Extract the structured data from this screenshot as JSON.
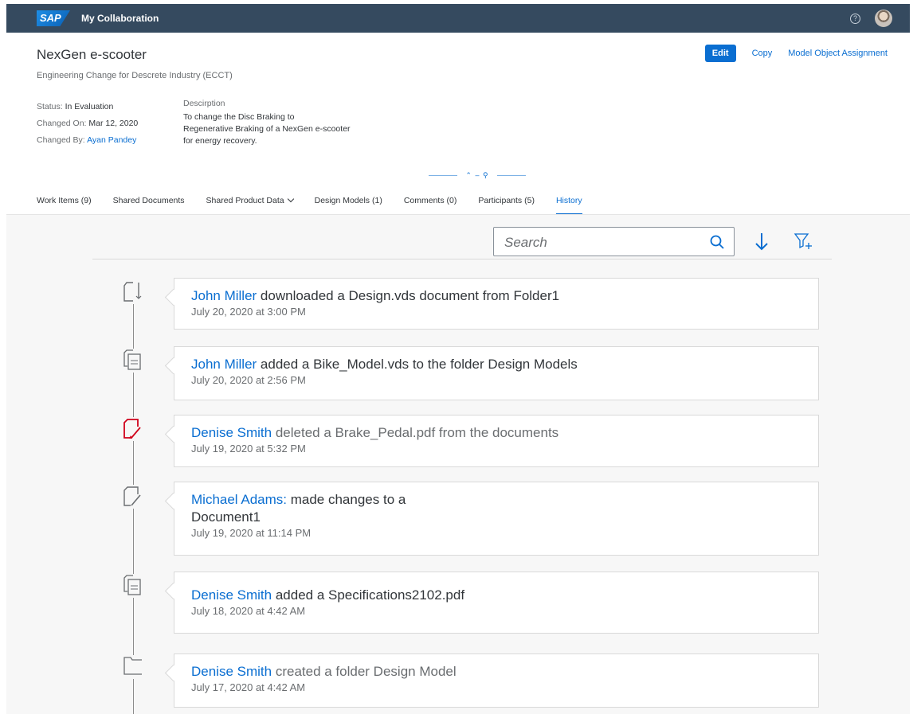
{
  "shell": {
    "logo": "SAP",
    "title": "My Collaboration",
    "help_icon": "?"
  },
  "header": {
    "title": "NexGen e-scooter",
    "subtitle": "Engineering Change for Descrete Industry (ECCT)",
    "actions": {
      "edit": "Edit",
      "copy": "Copy",
      "assignment": "Model Object Assignment"
    },
    "status_label": "Status:",
    "status_value": "In Evaluation",
    "changed_on_label": "Changed On:",
    "changed_on_value": "Mar 12, 2020",
    "changed_by_label": "Changed By:",
    "changed_by_value": "Ayan Pandey",
    "description_label": "Descirption",
    "description_lines": [
      "To change the Disc Braking to",
      "Regenerative Braking of a NexGen e-scooter",
      "for energy recovery."
    ]
  },
  "tabs": [
    {
      "label": "Work Items (9)"
    },
    {
      "label": "Shared Documents"
    },
    {
      "label": "Shared Product Data"
    },
    {
      "label": "Design Models (1)"
    },
    {
      "label": "Comments (0)"
    },
    {
      "label": "Participants (5)"
    },
    {
      "label": "History"
    }
  ],
  "active_tab": "History",
  "search": {
    "placeholder": "Search"
  },
  "colors": {
    "brand_blue": "#0a6ed1",
    "shell_bg": "#354a5f",
    "delete_red": "#d0021b",
    "text": "#32363a",
    "muted": "#6a6d70"
  },
  "history": [
    {
      "icon": "document-download-icon",
      "user": "John Miller",
      "action": " downloaded a Design.vds document from Folder1",
      "action2": "",
      "time": "July 20, 2020 at 3:00 PM"
    },
    {
      "icon": "documents-copy-icon",
      "user": "John Miller",
      "action": " added a Bike_Model.vds to the folder Design Models",
      "action2": "",
      "time": "July 20, 2020 at 2:56 PM"
    },
    {
      "icon": "document-delete-icon",
      "user": "Denise Smith",
      "action": " deleted a Brake_Pedal.pdf from the documents",
      "action2": "",
      "time": "July 19, 2020 at 5:32 PM"
    },
    {
      "icon": "document-edit-icon",
      "user": "Michael Adams:",
      "action": " made changes to a",
      "action2": "Document1",
      "time": "July 19, 2020 at 11:14 PM"
    },
    {
      "icon": "documents-add-icon",
      "user": "Denise Smith",
      "action": " added a Specifications2102.pdf",
      "action2": "",
      "time": "July 18, 2020 at 4:42 AM"
    },
    {
      "icon": "folder-icon",
      "user": "Denise Smith",
      "action": " created a folder Design Model",
      "action2": "",
      "time": "July 17, 2020 at 4:42 AM"
    }
  ]
}
